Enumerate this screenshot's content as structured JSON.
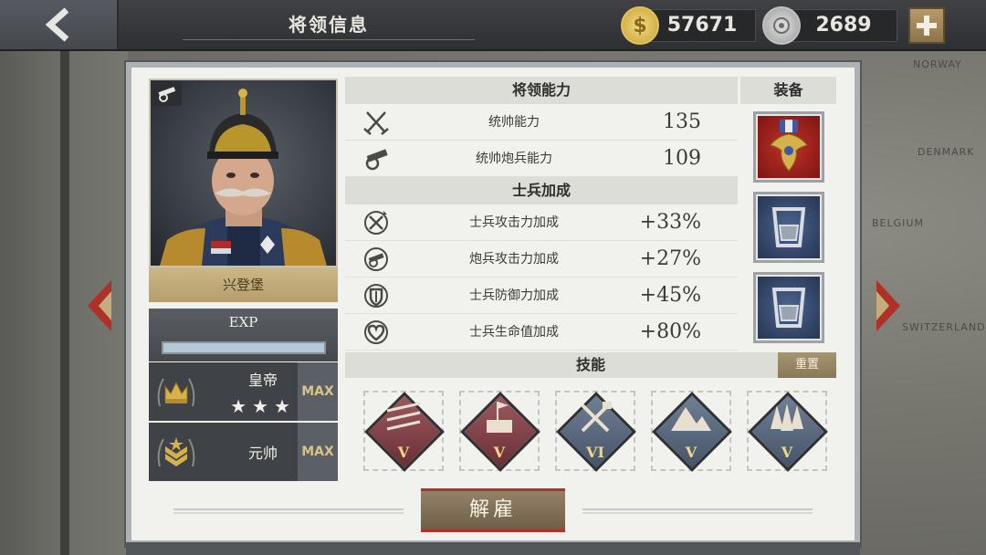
{
  "header": {
    "title": "将领信息",
    "gold": "57671",
    "medals": "2689",
    "gold_icon": "gold-coin-icon",
    "medal_icon": "silver-medal-icon"
  },
  "map_labels": [
    "NORWAY",
    "DENMARK",
    "BELGIUM",
    "SWITZERLAND"
  ],
  "general": {
    "name": "兴登堡",
    "exp_label": "EXP",
    "exp_progress": 1.0,
    "ranks": [
      {
        "name": "皇帝",
        "stars": "★★★",
        "max_label": "MAX",
        "icon": "crown-icon"
      },
      {
        "name": "元帅",
        "max_label": "MAX",
        "icon": "marshal-insignia-icon"
      }
    ]
  },
  "abilities": {
    "header": "将领能力",
    "items": [
      {
        "label": "统帅能力",
        "value": "135",
        "icon": "crossed-swords-icon"
      },
      {
        "label": "统帅炮兵能力",
        "value": "109",
        "icon": "cannon-icon"
      }
    ]
  },
  "bonuses": {
    "header": "士兵加成",
    "items": [
      {
        "label": "士兵攻击力加成",
        "value": "+33%",
        "icon": "attack-up-icon"
      },
      {
        "label": "炮兵攻击力加成",
        "value": "+27%",
        "icon": "artillery-up-icon"
      },
      {
        "label": "士兵防御力加成",
        "value": "+45%",
        "icon": "shield-up-icon"
      },
      {
        "label": "士兵生命值加成",
        "value": "+80%",
        "icon": "heart-up-icon"
      }
    ]
  },
  "equipment": {
    "header": "装备",
    "slots": [
      {
        "icon": "eagle-medal-icon"
      },
      {
        "icon": "armor-plate-icon"
      },
      {
        "icon": "armor-plate-icon"
      }
    ]
  },
  "skills": {
    "header": "技能",
    "reset_label": "重置",
    "items": [
      {
        "level": "V",
        "icon": "arrows-volley-icon",
        "color": "#7a3c44"
      },
      {
        "level": "V",
        "icon": "fortress-flag-icon",
        "color": "#7a3c44"
      },
      {
        "level": "VI",
        "icon": "crossed-tools-icon",
        "color": "#56647a"
      },
      {
        "level": "V",
        "icon": "mountains-icon",
        "color": "#56647a"
      },
      {
        "level": "V",
        "icon": "forest-icon",
        "color": "#56647a"
      }
    ]
  },
  "actions": {
    "dismiss_label": "解雇"
  },
  "colors": {
    "gold": "#d6b04a",
    "accent_red": "#b0302a",
    "nameplate": "#c2ab79"
  }
}
